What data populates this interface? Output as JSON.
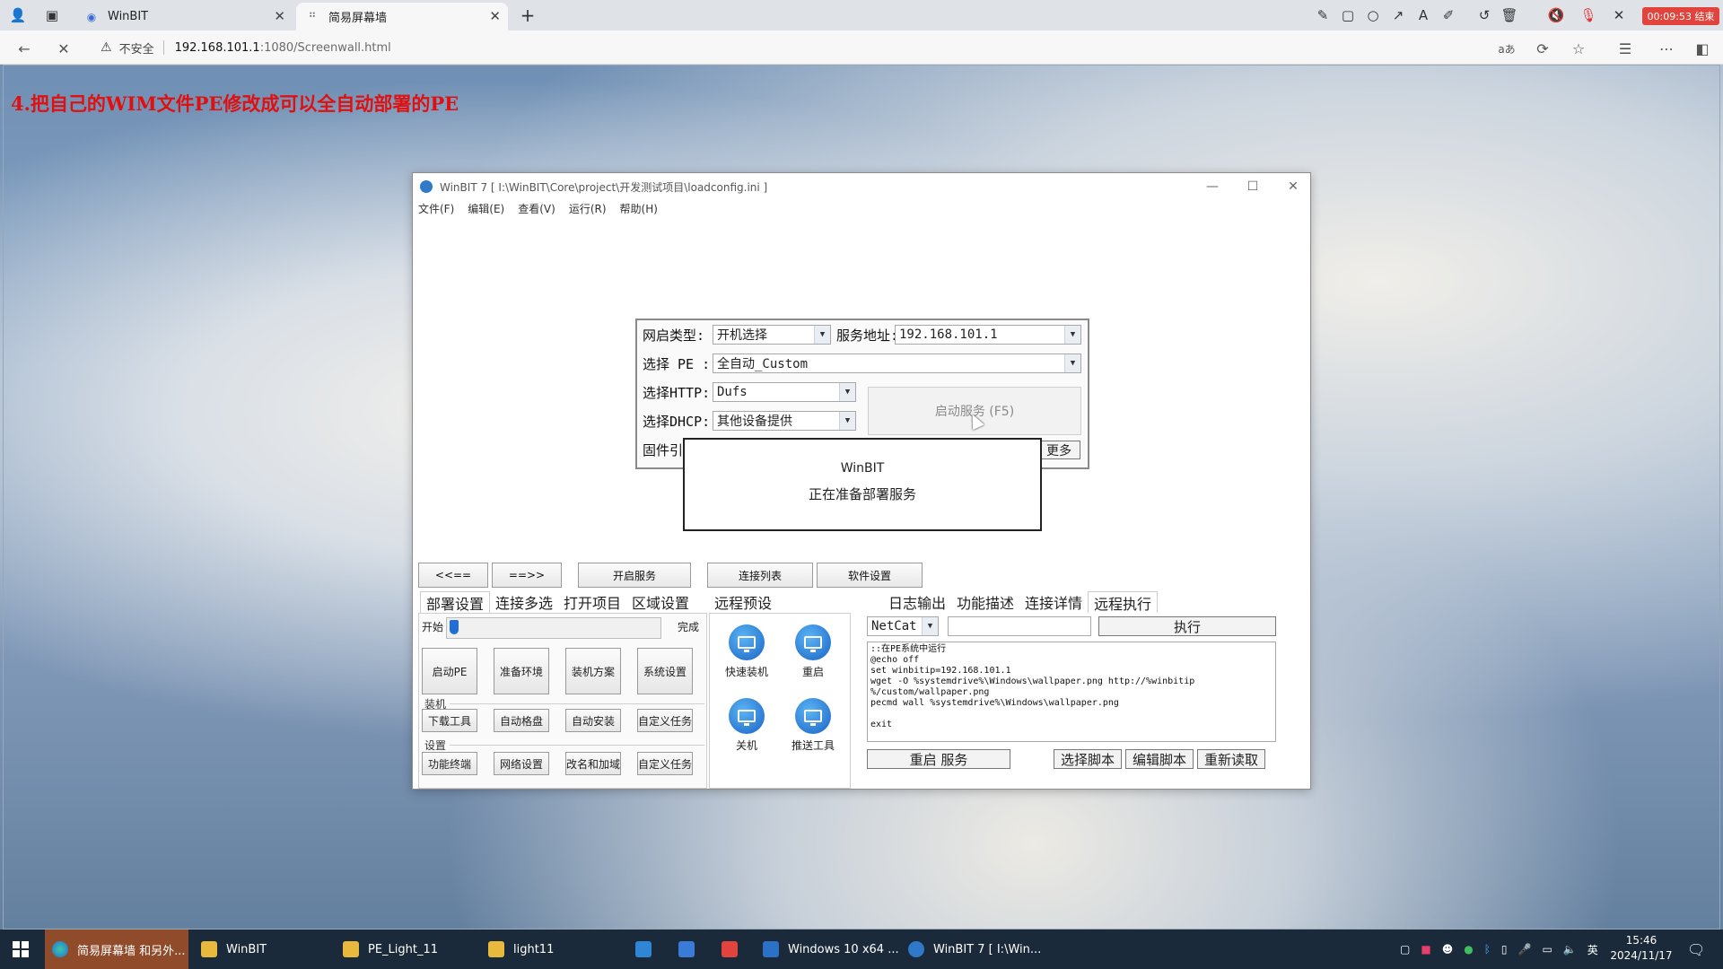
{
  "browser": {
    "tabs": [
      {
        "title": "WinBIT",
        "active": false
      },
      {
        "title": "简易屏幕墙",
        "active": true
      }
    ],
    "toolbar_icons": [
      "pen-icon",
      "rect-icon",
      "circle-icon",
      "arrow-icon",
      "text-icon",
      "highlight-icon",
      "undo-icon",
      "trash-icon",
      "mute-icon",
      "mic-off-icon",
      "close-icon"
    ],
    "record_badge": "00:09:53 结束",
    "security_label": "不安全",
    "url_host": "192.168.101.1",
    "url_path": ":1080/Screenwall.html"
  },
  "page": {
    "headline": "4.把自己的WIM文件PE修改成可以全自动部署的PE"
  },
  "window": {
    "title": "WinBIT 7 [ I:\\WinBIT\\Core\\project\\开发测试项目\\loadconfig.ini ]",
    "menu": [
      "文件(F)",
      "编辑(E)",
      "查看(V)",
      "运行(R)",
      "帮助(H)"
    ],
    "config": {
      "boot_type_label": "网启类型:",
      "boot_type_value": "开机选择",
      "server_label": "服务地址:",
      "server_value": "192.168.101.1",
      "pe_label": "选择 PE :",
      "pe_value": "全自动_Custom",
      "http_label": "选择HTTP:",
      "http_value": "Dufs",
      "dhcp_label": "选择DHCP:",
      "dhcp_value": "其他设备提供",
      "firmware_label": "固件引",
      "start_service": "启动服务 (F5)",
      "more": "更多"
    },
    "modal": {
      "title": "WinBIT",
      "message": "正在准备部署服务"
    },
    "row_buttons": {
      "prev": "<<==",
      "next": "==>>",
      "open_service": "开启服务",
      "connect_list": "连接列表",
      "software_settings": "软件设置"
    },
    "left_tabs": [
      "部署设置",
      "连接多选",
      "打开项目",
      "区域设置"
    ],
    "mid_tab": "远程预设",
    "right_tabs": [
      "日志输出",
      "功能描述",
      "连接详情",
      "远程执行"
    ],
    "deploy": {
      "start": "开始",
      "finish": "完成",
      "progress": 0.0,
      "big_buttons": [
        "启动PE",
        "准备环境",
        "装机方案",
        "系统设置"
      ],
      "group1": "装机",
      "group1_buttons": [
        "下载工具",
        "自动格盘",
        "自动安装",
        "自定义任务"
      ],
      "group2": "设置",
      "group2_buttons": [
        "功能终端",
        "网络设置",
        "改名和加域",
        "自定义任务"
      ]
    },
    "remote": [
      {
        "label": "快速装机",
        "icon": "monitor-icon"
      },
      {
        "label": "重启",
        "icon": "monitor-icon"
      },
      {
        "label": "关机",
        "icon": "monitor-icon"
      },
      {
        "label": "推送工具",
        "icon": "monitor-icon"
      }
    ],
    "exec": {
      "tool": "NetCat",
      "command": "",
      "execute": "执行",
      "script": "::在PE系统中运行\n@echo off\nset winbitip=192.168.101.1\nwget -O %systemdrive%\\Windows\\wallpaper.png http://%winbitip\n%/custom/wallpaper.png\npecmd wall %systemdrive%\\Windows\\wallpaper.png\n\nexit",
      "restart_service": "重启 服务",
      "select_script": "选择脚本",
      "edit_script": "编辑脚本",
      "reload": "重新读取"
    }
  },
  "taskbar": {
    "items": [
      {
        "label": "简易屏幕墙 和另外...",
        "active": true
      },
      {
        "label": "WinBIT",
        "active": false
      },
      {
        "label": "PE_Light_11",
        "active": false
      },
      {
        "label": "light11",
        "active": false
      },
      {
        "label": "Windows 10 x64 ...",
        "active": false
      },
      {
        "label": "WinBIT 7 [ I:\\Win...",
        "active": false
      }
    ],
    "ime": "英",
    "time": "15:46",
    "date": "2024/11/17"
  }
}
